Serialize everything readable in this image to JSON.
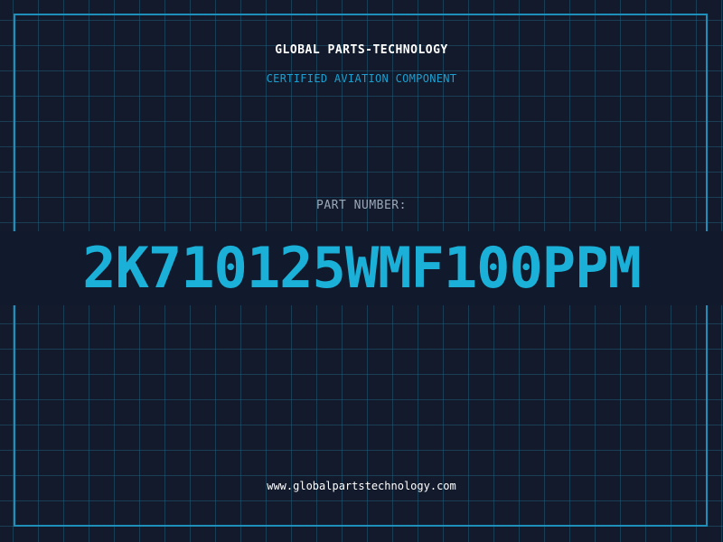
{
  "header": {
    "company": "GLOBAL PARTS-TECHNOLOGY",
    "tagline": "CERTIFIED AVIATION COMPONENT"
  },
  "part": {
    "label": "PART NUMBER:",
    "number": "2K710125WMF100PPM"
  },
  "footer": {
    "website": "www.globalpartstechnology.com"
  },
  "colors": {
    "background": "#121a2c",
    "grid": "#205a78",
    "border": "#1e8fb8",
    "accent": "#1ab0d8"
  }
}
